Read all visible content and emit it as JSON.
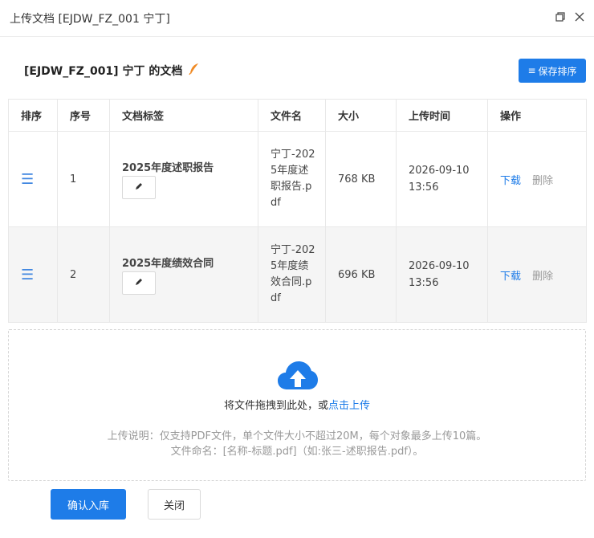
{
  "dialog": {
    "title": "上传文档 [EJDW_FZ_001 宁丁]"
  },
  "header": {
    "title": "[EJDW_FZ_001] 宁丁 的文档",
    "save_order_label": "保存排序",
    "save_order_icon": "≡"
  },
  "table": {
    "columns": [
      "排序",
      "序号",
      "文档标签",
      "文件名",
      "大小",
      "上传时间",
      "操作"
    ],
    "rows": [
      {
        "index": "1",
        "label": "2025年度述职报告",
        "filename": "宁丁-2025年度述职报告.pdf",
        "size": "768 KB",
        "uploaded": "2026-09-10 13:56",
        "download": "下载",
        "delete": "删除"
      },
      {
        "index": "2",
        "label": "2025年度绩效合同",
        "filename": "宁丁-2025年度绩效合同.pdf",
        "size": "696 KB",
        "uploaded": "2026-09-10 13:56",
        "download": "下载",
        "delete": "删除"
      }
    ]
  },
  "upload": {
    "prompt_prefix": "将文件拖拽到此处，或",
    "prompt_link": "点击上传",
    "hint_line1": "上传说明：仅支持PDF文件，单个文件大小不超过20M，每个对象最多上传10篇。",
    "hint_line2": "文件命名：[名称-标题.pdf]（如:张三-述职报告.pdf）。"
  },
  "footer": {
    "confirm_label": "确认入库",
    "close_label": "关闭"
  },
  "colors": {
    "primary": "#1e7ce8",
    "muted": "#999999",
    "feather": "#f08a24"
  },
  "icons": {
    "title_restore": "restore-icon",
    "title_close": "close-icon",
    "feather": "feather-icon",
    "drag": "drag-handle-icon",
    "edit": "pencil-icon",
    "upload": "cloud-upload-icon"
  }
}
